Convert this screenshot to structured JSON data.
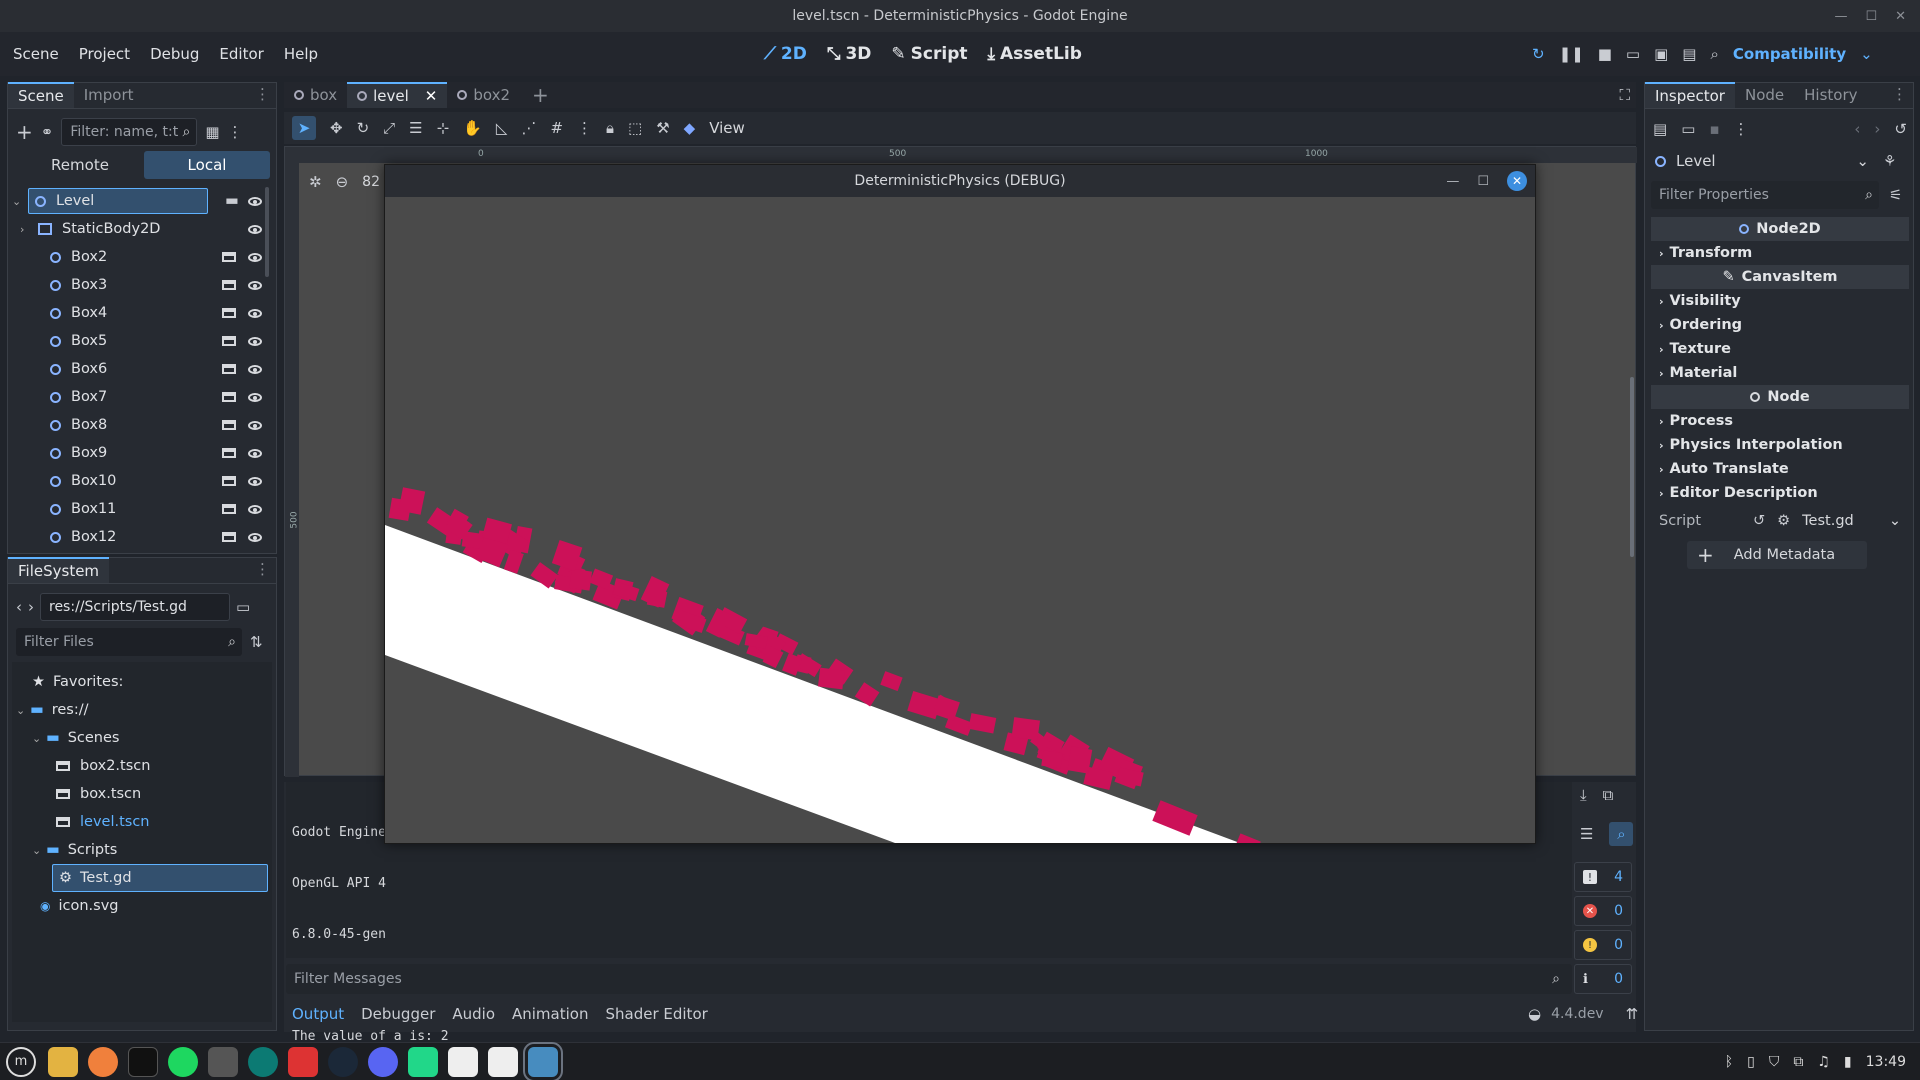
{
  "window": {
    "title": "level.tscn - DeterministicPhysics - Godot Engine"
  },
  "menu": {
    "items": [
      "Scene",
      "Project",
      "Debug",
      "Editor",
      "Help"
    ]
  },
  "main_screens": {
    "b2d": "2D",
    "b3d": "3D",
    "script": "Script",
    "assetlib": "AssetLib"
  },
  "renderer": {
    "label": "Compatibility"
  },
  "scene_dock": {
    "tabs": {
      "scene": "Scene",
      "import": "Import"
    },
    "filter_placeholder": "Filter: name, t:t",
    "remote": "Remote",
    "local": "Local",
    "nodes": [
      "Level",
      "StaticBody2D",
      "Box2",
      "Box3",
      "Box4",
      "Box5",
      "Box6",
      "Box7",
      "Box8",
      "Box9",
      "Box10",
      "Box11",
      "Box12"
    ]
  },
  "filesystem": {
    "tab": "FileSystem",
    "path": "res://Scripts/Test.gd",
    "filter_placeholder": "Filter Files",
    "favorites": "Favorites:",
    "root": "res://",
    "scenes_folder": "Scenes",
    "scene_files": [
      "box2.tscn",
      "box.tscn",
      "level.tscn"
    ],
    "scripts_folder": "Scripts",
    "script_file": "Test.gd",
    "icon_file": "icon.svg"
  },
  "editor_tabs": [
    "box",
    "level",
    "box2"
  ],
  "viewport": {
    "view_label": "View",
    "ruler_labels": [
      "0",
      "500",
      "1000"
    ],
    "ruler_side": "500",
    "zoom_partial": "82"
  },
  "game_window": {
    "title": "DeterministicPhysics (DEBUG)",
    "accent": "#cc1158"
  },
  "output": {
    "lines": [
      "Godot Engine",
      "OpenGL API 4",
      "6.8.0-45-gen",
      "",
      "The value of a is: 2"
    ],
    "filter_placeholder": "Filter Messages",
    "counts": {
      "messages": "4",
      "errors": "0",
      "warnings": "0",
      "info": "0"
    }
  },
  "bottom_tabs": [
    "Output",
    "Debugger",
    "Audio",
    "Animation",
    "Shader Editor"
  ],
  "version": "4.4.dev",
  "inspector": {
    "tabs": {
      "inspector": "Inspector",
      "node": "Node",
      "history": "History"
    },
    "object": "Level",
    "filter_placeholder": "Filter Properties",
    "cat_node2d": "Node2D",
    "node2d_sections": [
      "Transform"
    ],
    "cat_canvasitem": "CanvasItem",
    "canvasitem_sections": [
      "Visibility",
      "Ordering",
      "Texture",
      "Material"
    ],
    "cat_node": "Node",
    "node_sections": [
      "Process",
      "Physics Interpolation",
      "Auto Translate",
      "Editor Description"
    ],
    "script_label": "Script",
    "script_value": "Test.gd",
    "add_metadata": "Add Metadata"
  },
  "clock": "13:49"
}
